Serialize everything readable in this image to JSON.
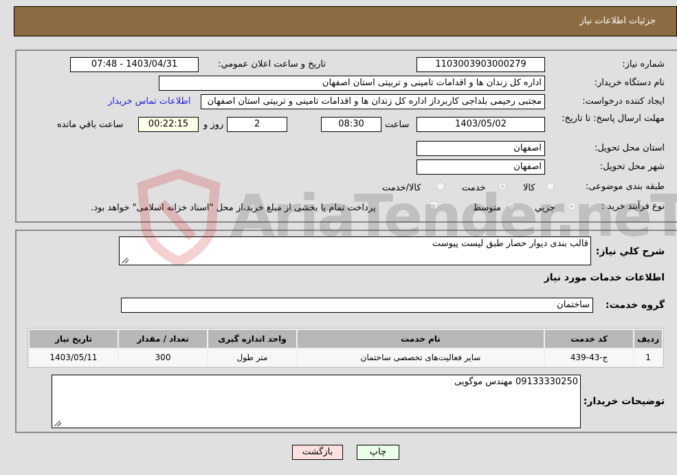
{
  "header": {
    "title": "جزئیات اطلاعات نیاز"
  },
  "form": {
    "need_number_label": "شماره نیاز:",
    "need_number": "1103003903000279",
    "announce_label": "تاریخ و ساعت اعلان عمومي:",
    "announce_value": "1403/04/31 - 07:48",
    "buyer_org_label": "نام دستگاه خریدار:",
    "buyer_org": "اداره کل زندان ها و اقدامات تامینی و تربیتی استان اصفهان",
    "creator_label": "ایجاد کننده درخواست:",
    "creator": "مجتبی رحیمی بلداجی کاربرداز اداره کل زندان ها و اقدامات تامینی و تربیتی استان اصفهان",
    "contact_link": "اطلاعات تماس خریدار",
    "deadline_label": "مهلت ارسال پاسخ: تا تاریخ:",
    "deadline_date": "1403/05/02",
    "time_label": "ساعت",
    "deadline_time": "08:30",
    "days_value": "2",
    "days_label": "روز و",
    "remaining_time": "00:22:15",
    "remaining_label": "ساعت باقي مانده",
    "province_label": "استان محل تحویل:",
    "province": "اصفهان",
    "city_label": "شهر محل تحویل:",
    "city": "اصفهان",
    "category_label": "طبقه بندی موضوعی:",
    "category_options": [
      {
        "label": "کالا",
        "checked": false
      },
      {
        "label": "خدمت",
        "checked": true
      },
      {
        "label": "کالا/خدمت",
        "checked": false
      }
    ],
    "process_label": "نوع فرآیند خرید :",
    "process_options": [
      {
        "label": "جزيي",
        "checked": true
      },
      {
        "label": "متوسط",
        "checked": false
      }
    ],
    "treasury_note": "پرداخت تمام یا بخشی از مبلغ خرید،از محل \"اسناد خزانه اسلامی\" خواهد بود."
  },
  "details": {
    "description_label": "شرح کلي نیاز:",
    "description": "قالب بندی دیوار حصار طبق لیست پیوست",
    "services_heading": "اطلاعات خدمات مورد نیاز",
    "service_group_label": "گروه خدمت:",
    "service_group": "ساختمان",
    "table": {
      "headers": [
        "ردیف",
        "کد خدمت",
        "نام خدمت",
        "واحد اندازه گیری",
        "تعداد / مقدار",
        "تاریخ نیاز"
      ],
      "rows": [
        [
          "1",
          "ج-43-439",
          "سایر فعالیت‌های تخصصی ساختمان",
          "متر طول",
          "300",
          "1403/05/11"
        ]
      ]
    },
    "buyer_notes_label": "توضیحات خریدار:",
    "buyer_notes": "09133330250 مهندس موگویی"
  },
  "buttons": {
    "print": "چاپ",
    "back": "بازگشت"
  },
  "watermark": {
    "text": "AriaTender.neT"
  }
}
